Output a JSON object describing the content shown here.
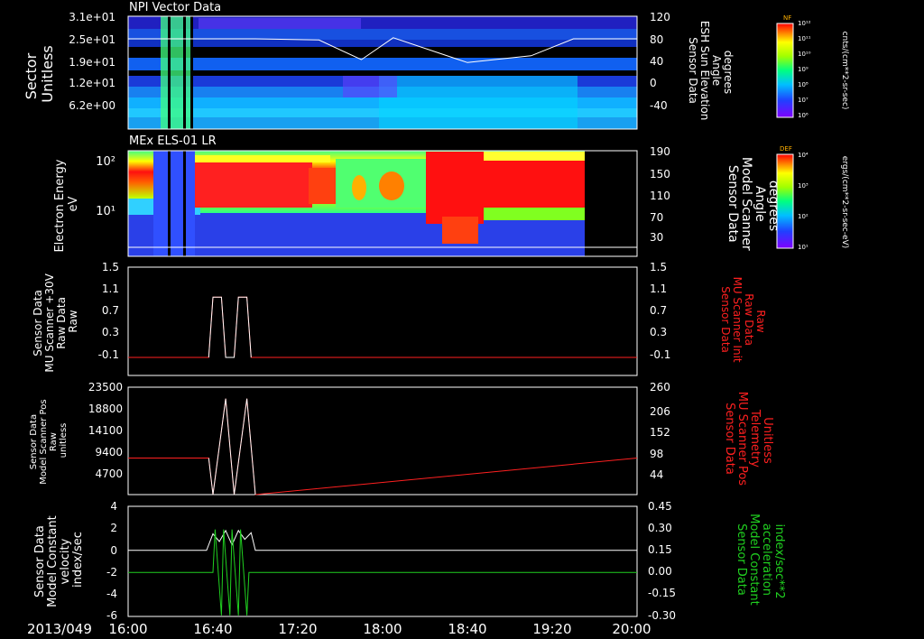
{
  "date_label": "2013/049",
  "time_ticks": [
    "16:00",
    "16:40",
    "17:20",
    "18:00",
    "18:40",
    "19:20",
    "20:00"
  ],
  "chart_data": [
    {
      "type": "heatmap",
      "title": "NPI Vector Data",
      "ylabel": [
        "Sector",
        "Unitless"
      ],
      "yticks": [
        "3.1e+01",
        "2.5e+01",
        "1.9e+01",
        "1.2e+01",
        "6.2e+00"
      ],
      "ylabel_right": [
        "Sensor Data",
        "ESH Sun Elevation",
        "Angle",
        "degrees"
      ],
      "yticks_right": [
        "120",
        "80",
        "40",
        "0",
        "-40"
      ],
      "ylim_right": [
        -80,
        120
      ],
      "overlay": {
        "type": "line",
        "name": "ESH Sun Elevation Angle",
        "x": [
          "16:00",
          "16:20",
          "17:00",
          "17:30",
          "17:50",
          "18:05",
          "18:40",
          "19:10",
          "19:30",
          "20:00"
        ],
        "y": [
          80,
          80,
          80,
          78,
          43,
          82,
          38,
          50,
          80,
          80
        ]
      },
      "colorbar": {
        "label": "NF",
        "units": "cnts/(cm**2-sr-sec)",
        "ticks": [
          "10¹²",
          "10¹¹",
          "10¹⁰",
          "10⁹",
          "10⁸",
          "10⁷",
          "10⁶"
        ]
      }
    },
    {
      "type": "heatmap",
      "title": "MEx ELS-01 LR",
      "ylabel": [
        "Electron Energy",
        "eV"
      ],
      "yticks": [
        "10²",
        "10¹"
      ],
      "ylabel_right": [
        "Sensor Data",
        "Model Scanner",
        "Angle",
        "degrees"
      ],
      "yticks_right": [
        "190",
        "150",
        "110",
        "70",
        "30"
      ],
      "ylim_right": [
        0,
        190
      ],
      "colorbar": {
        "label": "DEF",
        "units": "ergs/(cm**2-sr-sec-eV)",
        "ticks": [
          "10⁴",
          "10³",
          "10²",
          "10¹"
        ]
      }
    },
    {
      "type": "line",
      "ylabel": [
        "Sensor Data",
        "MU Scanner +30V",
        "Raw Data",
        "Raw"
      ],
      "yticks": [
        "1.5",
        "1.1",
        "0.7",
        "0.3",
        "-0.1"
      ],
      "ylim": [
        -0.3,
        1.5
      ],
      "ylabel_right": [
        "Sensor Data",
        "MU Scanner Init",
        "Raw Data",
        "Raw"
      ],
      "yticks_right": [
        "1.5",
        "1.1",
        "0.7",
        "0.3",
        "-0.1"
      ],
      "series": [
        {
          "color": "#ff2020",
          "x": [
            "16:00",
            "16:38",
            "16:40",
            "16:44",
            "16:46",
            "16:50",
            "16:52",
            "16:56",
            "16:58",
            "20:00"
          ],
          "y": [
            0,
            0,
            1,
            1,
            0,
            0,
            1,
            1,
            0,
            0
          ]
        },
        {
          "color": "#ffffff",
          "x": [
            "16:38",
            "16:40",
            "16:44",
            "16:46",
            "16:50",
            "16:52",
            "16:56",
            "16:58"
          ],
          "y": [
            0,
            1,
            1,
            0,
            0,
            1,
            1,
            0
          ]
        }
      ]
    },
    {
      "type": "line",
      "ylabel": [
        "Sensor Data",
        "Model Scanner Pos",
        "Raw",
        "unitless"
      ],
      "yticks": [
        "23500",
        "18800",
        "14100",
        "9400",
        "4700"
      ],
      "ylim": [
        0,
        23500
      ],
      "ylabel_right": [
        "Sensor Data",
        "MU Scanner Pos",
        "Telemetry",
        "Unitless"
      ],
      "yticks_right": [
        "260",
        "206",
        "152",
        "98",
        "44"
      ],
      "series": [
        {
          "color": "#ff2020",
          "x": [
            "16:00",
            "16:38",
            "16:40",
            "16:46",
            "16:50",
            "16:56",
            "17:00",
            "20:00"
          ],
          "y": [
            8000,
            8000,
            0,
            21000,
            0,
            21000,
            0,
            8000
          ]
        },
        {
          "color": "#ffffff",
          "x": [
            "16:38",
            "16:40",
            "16:46",
            "16:50",
            "16:56",
            "17:00"
          ],
          "y": [
            8000,
            0,
            21000,
            0,
            21000,
            0
          ]
        }
      ]
    },
    {
      "type": "line",
      "ylabel": [
        "Sensor Data",
        "Model Constant",
        "velocity",
        "index/sec"
      ],
      "yticks": [
        "4",
        "2",
        "0",
        "-2",
        "-4",
        "-6"
      ],
      "ylim": [
        -6,
        4
      ],
      "ylabel_right": [
        "Sensor Data",
        "Model Constant",
        "acceleration",
        "index/sec**2"
      ],
      "yticks_right": [
        "0.45",
        "0.30",
        "0.15",
        "0.00",
        "-0.15",
        "-0.30"
      ],
      "series": [
        {
          "color": "#ffffff",
          "x": [
            "16:00",
            "16:37",
            "16:40",
            "16:43",
            "16:46",
            "16:49",
            "16:52",
            "16:55",
            "16:58",
            "17:00",
            "20:00"
          ],
          "y": [
            0,
            0,
            1.5,
            0.8,
            1.8,
            0.5,
            1.8,
            1.0,
            1.6,
            0,
            0
          ]
        },
        {
          "color": "#20d020",
          "x": [
            "16:00",
            "16:40",
            "16:41",
            "16:44",
            "16:45",
            "16:48",
            "16:49",
            "16:52",
            "16:53",
            "16:56",
            "16:57",
            "20:00"
          ],
          "y": [
            -2,
            -2,
            1.9,
            -5.9,
            1.9,
            -5.9,
            1.9,
            -5.9,
            1.9,
            -5.9,
            -2,
            -2
          ]
        }
      ]
    }
  ]
}
